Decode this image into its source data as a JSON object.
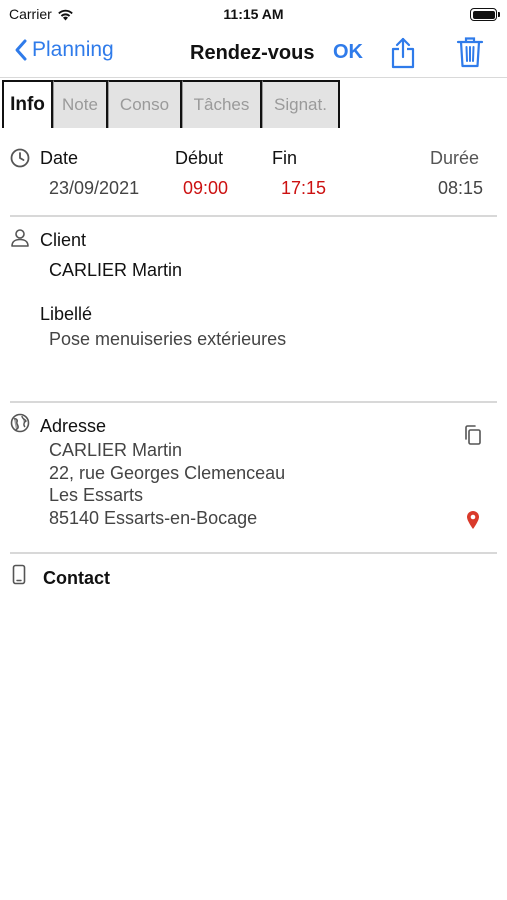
{
  "status": {
    "carrier": "Carrier",
    "time": "11:15 AM"
  },
  "nav": {
    "back_label": "Planning",
    "title": "Rendez-vous",
    "ok_label": "OK"
  },
  "tabs": [
    {
      "label": "Info",
      "active": true
    },
    {
      "label": "Note"
    },
    {
      "label": "Conso"
    },
    {
      "label": "Tâches"
    },
    {
      "label": "Signat."
    }
  ],
  "date_section": {
    "date_label": "Date",
    "debut_label": "Début",
    "fin_label": "Fin",
    "duree_label": "Durée",
    "date_value": "23/09/2021",
    "debut_value": "09:00",
    "fin_value": "17:15",
    "duree_value": "08:15"
  },
  "client_section": {
    "client_label": "Client",
    "client_value": "CARLIER Martin",
    "libelle_label": "Libellé",
    "libelle_value": "Pose menuiseries extérieures"
  },
  "address_section": {
    "label": "Adresse",
    "lines": [
      "CARLIER Martin",
      "22, rue Georges Clemenceau",
      "Les Essarts",
      "85140 Essarts-en-Bocage"
    ]
  },
  "contact_section": {
    "label": "Contact"
  },
  "colors": {
    "accent": "#2f7bea",
    "time_red": "#cc1111",
    "pin_red": "#d93a2b"
  }
}
